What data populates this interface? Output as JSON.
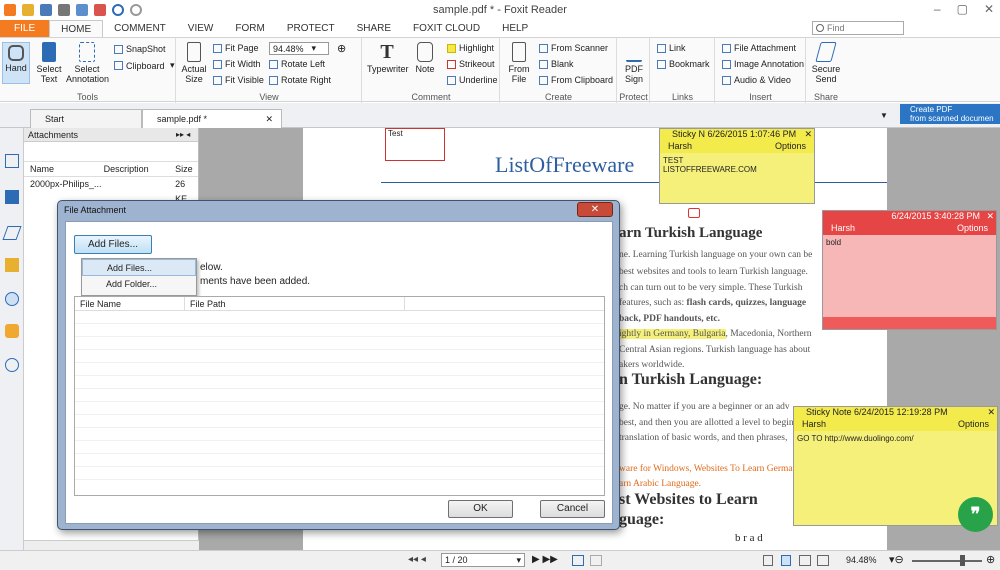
{
  "app": {
    "title": "sample.pdf * - Foxit Reader"
  },
  "ribbon_tabs": [
    "FILE",
    "HOME",
    "COMMENT",
    "VIEW",
    "FORM",
    "PROTECT",
    "SHARE",
    "FOXIT CLOUD",
    "HELP"
  ],
  "find": {
    "placeholder": "Find"
  },
  "ribbon": {
    "tools": {
      "label": "Tools",
      "hand": "Hand",
      "select_text": "Select Text",
      "select_annotation": "Select Annotation",
      "snapshot": "SnapShot",
      "clipboard": "Clipboard"
    },
    "view": {
      "label": "View",
      "actual_size": "Actual Size",
      "fit_page": "Fit Page",
      "fit_width": "Fit Width",
      "fit_visible": "Fit Visible",
      "zoom": "94.48%",
      "rotate_left": "Rotate Left",
      "rotate_right": "Rotate Right"
    },
    "comment": {
      "label": "Comment",
      "typewriter": "Typewriter",
      "note": "Note",
      "highlight": "Highlight",
      "strikeout": "Strikeout",
      "underline": "Underline"
    },
    "create": {
      "label": "Create",
      "from_file": "From File",
      "from_scanner": "From Scanner",
      "blank": "Blank",
      "from_clipboard": "From Clipboard"
    },
    "protect": {
      "label": "Protect",
      "pdf_sign": "PDF Sign"
    },
    "links": {
      "label": "Links",
      "link": "Link",
      "bookmark": "Bookmark"
    },
    "insert": {
      "label": "Insert",
      "file_attachment": "File Attachment",
      "image_annotation": "Image Annotation",
      "audio_video": "Audio & Video"
    },
    "share": {
      "label": "Share",
      "secure_send": "Secure Send"
    }
  },
  "doc_tabs": [
    "Start",
    "sample.pdf *"
  ],
  "banner": {
    "line1": "Create PDF",
    "line2": "from scanned documen"
  },
  "attachments": {
    "title": "Attachments",
    "columns": [
      "Name",
      "Description",
      "Size"
    ],
    "rows": [
      {
        "name": "2000px-Philips_...",
        "description": "",
        "size": "26 KE"
      }
    ]
  },
  "dialog": {
    "title": "File Attachment",
    "add_files": "Add Files...",
    "menu": [
      "Add Files...",
      "Add Folder..."
    ],
    "info1": "elow.",
    "info2": "ments have been added.",
    "columns": [
      "File Name",
      "File Path"
    ],
    "ok": "OK",
    "cancel": "Cancel"
  },
  "page": {
    "small_box": "Test",
    "title": "ListOfFreeware",
    "h1": "arn Turkish Language",
    "p1": "ne. Learning Turkish language on your own can be",
    "p2": "best websites and tools to learn Turkish language.",
    "p3": "ch can turn out to be very simple. These Turkish",
    "p4a": "features, such as: ",
    "p4b": "flash cards, quizzes, language",
    "p5": "back, PDF handouts, etc.",
    "p6a": "ightly in Germany, Bulgaria",
    "p6b": ", Macedonia, Northern",
    "p7": "Central Asian regions. Turkish language has about",
    "p8": "akers worldwide.",
    "h2": "n Turkish Language:",
    "q1": "ge. No matter if you are a beginner or an adv",
    "q2": "best, and then you are allotted a level to begin",
    "q3": "translation of basic words, and then phrases,",
    "r1": "ware for Windows, Websites To Learn German",
    "r2": "arn Arabic Language.",
    "h3": "st Websites to Learn",
    "h4": "guage:",
    "brad": "b r a d"
  },
  "stickies": [
    {
      "header": "Sticky N 6/26/2015 1:07:46 PM",
      "author": "Harsh",
      "options": "Options",
      "body1": "TEST",
      "body2": "LISTOFFREEWARE.COM"
    },
    {
      "header": "6/24/2015 3:40:28 PM",
      "author": "Harsh",
      "options": "Options",
      "body1": "bold"
    },
    {
      "header": "Sticky Note 6/24/2015 12:19:28 PM",
      "author": "Harsh",
      "options": "Options",
      "body1": "GO TO http://www.duolingo.com/"
    }
  ],
  "status": {
    "page": "1 / 20",
    "zoom": "94.48%"
  },
  "colors": {
    "file_tab": "#f47b20",
    "sticky_yellow": "#f5f07a",
    "sticky_red": "#ef5b5b",
    "dialog_frame": "#9db3cf"
  }
}
